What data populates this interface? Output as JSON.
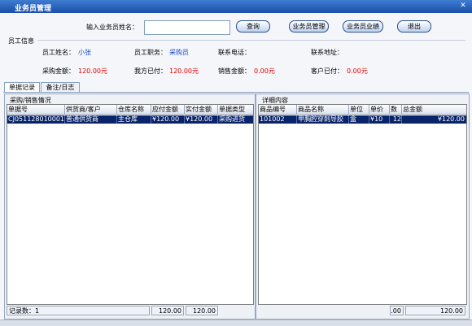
{
  "window": {
    "title": "业务员管理",
    "close_symbol": "✕"
  },
  "search": {
    "label": "输入业务员姓名：",
    "value": "",
    "buttons": [
      "查询",
      "业务员管理",
      "业务员业绩",
      "退出"
    ]
  },
  "employee_info": {
    "section_title": "员工信息",
    "fields": [
      {
        "label": "员工姓名：",
        "value": "小张"
      },
      {
        "label": "员工职务：",
        "value": "采购员"
      },
      {
        "label": "联系电话：",
        "value": ""
      },
      {
        "label": "联系地址：",
        "value": ""
      },
      {
        "label": "采购金额：",
        "value": "120.00元"
      },
      {
        "label": "我方已付：",
        "value": "120.00元"
      },
      {
        "label": "销售金额：",
        "value": "0.00元"
      },
      {
        "label": "客户已付：",
        "value": "0.00元"
      }
    ]
  },
  "tabs": [
    {
      "label": "单据记录",
      "active": true
    },
    {
      "label": "备注/日志",
      "active": false
    }
  ],
  "left_panel": {
    "title": "采购/销售情况",
    "columns": [
      "单据号",
      "供货商/客户",
      "仓库名称",
      "应付金额",
      "实付金额",
      "单据类型"
    ],
    "rows": [
      [
        "CJ051128010001",
        "普通供货商",
        "主仓库",
        "¥120.00",
        "¥120.00",
        "采购进货"
      ]
    ],
    "footer": {
      "record_label": "记录数：1",
      "total1": "120.00",
      "total2": "120.00"
    }
  },
  "right_panel": {
    "title": "详细内容",
    "columns": [
      "商品编号",
      "商品名称",
      "单位",
      "单价",
      "数",
      "总金额"
    ],
    "rows": [
      [
        "101002",
        "甲胸腔穿刺导胶",
        "盒",
        "¥10",
        "12",
        "¥120.00"
      ]
    ],
    "footer": {
      "total1": ".00",
      "total2": "120.00"
    }
  },
  "colors": {
    "title_bar": "#1b4ea8",
    "selection": "#0a246a",
    "amount_red": "#e00000",
    "value_blue": "#1a47c8"
  }
}
